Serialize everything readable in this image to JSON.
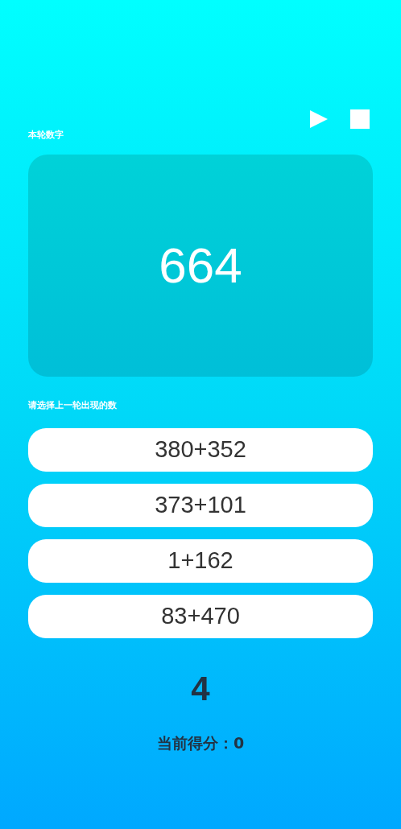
{
  "current_label": "本轮数字",
  "current_number": "664",
  "prompt": "请选择上一轮出现的数",
  "options": [
    {
      "label": "380+352"
    },
    {
      "label": "373+101"
    },
    {
      "label": "1+162"
    },
    {
      "label": "83+470"
    }
  ],
  "countdown": "4",
  "score": "当前得分：0"
}
